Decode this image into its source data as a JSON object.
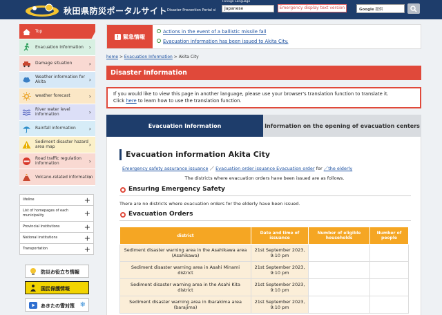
{
  "header": {
    "site_title": "秋田県防災ポータルサイト",
    "site_subtitle": "Disaster Prevention Portal si",
    "language_label": "Foreign Language",
    "language_value": "Japanese",
    "emergency_display": "Emergency display text version",
    "search_brand": "Google",
    "search_suffix": "提供"
  },
  "sidebar": {
    "nav": [
      {
        "label": "Top",
        "icon": "home-icon"
      },
      {
        "label": "Evacuation Information",
        "icon": "running-person-icon",
        "color": "#d8f0e2"
      },
      {
        "label": "Damage situation",
        "icon": "car-crash-icon",
        "color": "#f9d9d2"
      },
      {
        "label": "Weather information for Akita",
        "icon": "cloud-icon",
        "color": "#d6e8f7"
      },
      {
        "label": "weather forecast",
        "icon": "sun-icon",
        "color": "#fbe7c6"
      },
      {
        "label": "River water level information",
        "icon": "wave-icon",
        "color": "#dcdff7"
      },
      {
        "label": "Rainfall information",
        "icon": "umbrella-icon",
        "color": "#d6ecf7"
      },
      {
        "label": "Sediment disaster hazard area map",
        "icon": "warning-icon",
        "color": "#fbf0c8"
      },
      {
        "label": "Road traffic regulation information",
        "icon": "no-entry-icon",
        "color": "#f9d9d2"
      },
      {
        "label": "Volcano-related information",
        "icon": "volcano-icon",
        "color": "#f9d9d2"
      }
    ],
    "list": [
      {
        "label": "lifeline"
      },
      {
        "label": "List of homepages of each municipality"
      },
      {
        "label": "Provincial Institutions"
      },
      {
        "label": "National institutions"
      },
      {
        "label": "Transportation"
      }
    ],
    "banners": [
      {
        "label": "防災お役立ち情報"
      },
      {
        "label": "国民保護情報"
      },
      {
        "label": "あきたの雪対策"
      }
    ]
  },
  "alert": {
    "label": "緊急情報",
    "links": [
      "Actions in the event of a ballistic missile fall",
      "Evacuation information has been issued to Akita City."
    ]
  },
  "breadcrumb": {
    "home": "home",
    "sep": ">",
    "evac": "Evacuation Information",
    "current": "Akita City"
  },
  "page_title": "Disaster Information",
  "notice": {
    "text": "If you would like to view this page in another language, please use your browser's translation function to translate it.",
    "click": "Click",
    "here": "here",
    "rest": "to learn how to use the translation function."
  },
  "tabs": [
    "Evacuation Information",
    "Information on the opening of evacuation centers"
  ],
  "content": {
    "heading": "Evacuation information Akita City",
    "sub_link_1": "Emergency safety assurance issuance",
    "sub_sep": "／",
    "sub_link_2": "Evacuation order issuance Evacuation order",
    "sub_for": "for",
    "sub_link_3": "／the elderly",
    "intro": "The districts where evacuation orders have been issued are as follows.",
    "section_1": "Ensuring Emergency Safety",
    "section_1_text": "There are no districts where evacuation orders for the elderly have been issued.",
    "section_2": "Evacuation Orders",
    "table_headers": [
      "district",
      "Date and time of issuance",
      "Number of eligible households",
      "Number of people"
    ],
    "table_rows": [
      {
        "district": "Sediment disaster warning area in the Asahikawa area (Asahikawa)",
        "date": "21st September 2023, 9:10 pm",
        "households": "",
        "people": ""
      },
      {
        "district": "Sediment disaster warning area in Asahi Minami district",
        "date": "21st September 2023, 9:10 pm",
        "households": "",
        "people": ""
      },
      {
        "district": "Sediment disaster warning area in the Asahi Kita district",
        "date": "21st September 2023, 9:10 pm",
        "households": "",
        "people": ""
      },
      {
        "district": "Sediment disaster warning area in Ibarakima area (barajima)",
        "date": "21st September 2023, 9:10 pm",
        "households": "",
        "people": ""
      }
    ]
  }
}
